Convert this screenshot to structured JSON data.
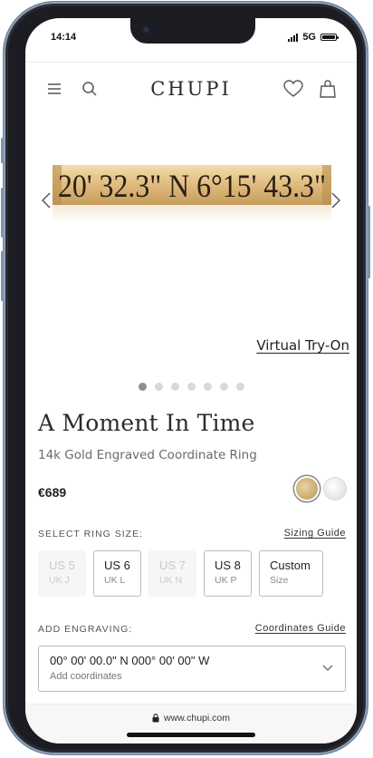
{
  "status_bar": {
    "time": "14:14",
    "network": "5G"
  },
  "header": {
    "brand": "CHUPI",
    "menu_icon": "hamburger-menu-icon",
    "search_icon": "search-icon",
    "wishlist_icon": "heart-icon",
    "bag_icon": "shopping-bag-icon"
  },
  "gallery": {
    "ring_engraving": "20' 32.3\" N   6°15' 43.3\"",
    "try_on_label": "Virtual Try-On",
    "slide_count": 7,
    "active_slide": 1
  },
  "product": {
    "title": "A Moment In Time",
    "subtitle": "14k Gold Engraved Coordinate Ring",
    "price": "€689",
    "metals": [
      {
        "name": "gold",
        "color": "#c9a86b",
        "selected": true
      },
      {
        "name": "white",
        "color": "#e8e8e8",
        "selected": false
      }
    ]
  },
  "ring_size": {
    "label": "SELECT RING SIZE:",
    "guide_link": "Sizing Guide",
    "options": [
      {
        "main": "US 5",
        "sub": "UK J",
        "available": false
      },
      {
        "main": "US 6",
        "sub": "UK L",
        "available": true
      },
      {
        "main": "US 7",
        "sub": "UK N",
        "available": false
      },
      {
        "main": "US 8",
        "sub": "UK P",
        "available": true
      },
      {
        "main": "Custom",
        "sub": "Size",
        "available": true
      }
    ]
  },
  "engraving": {
    "label": "ADD ENGRAVING:",
    "guide_link": "Coordinates Guide",
    "value": "00° 00' 00.0\" N 000° 00' 00\" W",
    "placeholder": "Add coordinates"
  },
  "browser": {
    "url": "www.chupi.com"
  }
}
